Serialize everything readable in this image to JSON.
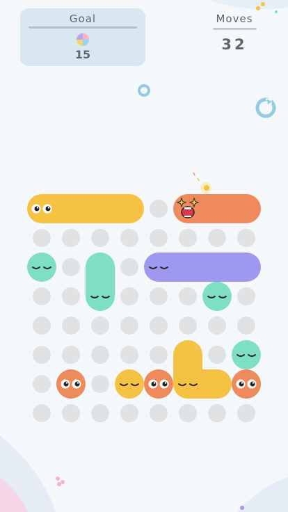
{
  "goal": {
    "title": "Goal",
    "count": "15",
    "icon": "rainbow-face-icon"
  },
  "moves": {
    "label": "Moves",
    "value": "32"
  },
  "colors": {
    "yellow": "#f6c244",
    "orange": "#ee8a5c",
    "mint": "#7fdfc3",
    "purple": "#9e99ef",
    "empty_cell": "#e0e2e4",
    "panel": "#d9e7f1",
    "text": "#5c6670",
    "accent": "#93cbe0"
  },
  "board": {
    "rows": 8,
    "cols": 8
  },
  "pieces": [
    {
      "color": "yellow",
      "face": "open-eyes",
      "cells": [
        [
          0,
          0
        ],
        [
          0,
          1
        ],
        [
          0,
          2
        ],
        [
          0,
          3
        ]
      ]
    },
    {
      "color": "orange",
      "face": "excited",
      "cells": [
        [
          0,
          5
        ],
        [
          0,
          6
        ],
        [
          0,
          7
        ]
      ]
    },
    {
      "color": "mint",
      "face": "sleepy",
      "cells": [
        [
          2,
          0
        ]
      ]
    },
    {
      "color": "mint",
      "face": "sleepy",
      "cells": [
        [
          2,
          2
        ],
        [
          3,
          2
        ]
      ]
    },
    {
      "color": "purple",
      "face": "sleepy",
      "cells": [
        [
          2,
          4
        ],
        [
          2,
          5
        ],
        [
          2,
          6
        ],
        [
          2,
          7
        ]
      ]
    },
    {
      "color": "mint",
      "face": "sleepy",
      "cells": [
        [
          3,
          6
        ]
      ]
    },
    {
      "color": "mint",
      "face": "sleepy",
      "cells": [
        [
          5,
          7
        ]
      ]
    },
    {
      "color": "yellow",
      "face": "sleepy",
      "cells": [
        [
          5,
          5
        ],
        [
          6,
          5
        ],
        [
          6,
          6
        ]
      ]
    },
    {
      "color": "orange",
      "face": "open-eyes",
      "cells": [
        [
          6,
          1
        ]
      ]
    },
    {
      "color": "yellow",
      "face": "sleepy",
      "cells": [
        [
          6,
          3
        ]
      ]
    },
    {
      "color": "orange",
      "face": "open-eyes",
      "cells": [
        [
          6,
          4
        ]
      ]
    },
    {
      "color": "orange",
      "face": "open-eyes",
      "cells": [
        [
          6,
          7
        ]
      ]
    }
  ]
}
